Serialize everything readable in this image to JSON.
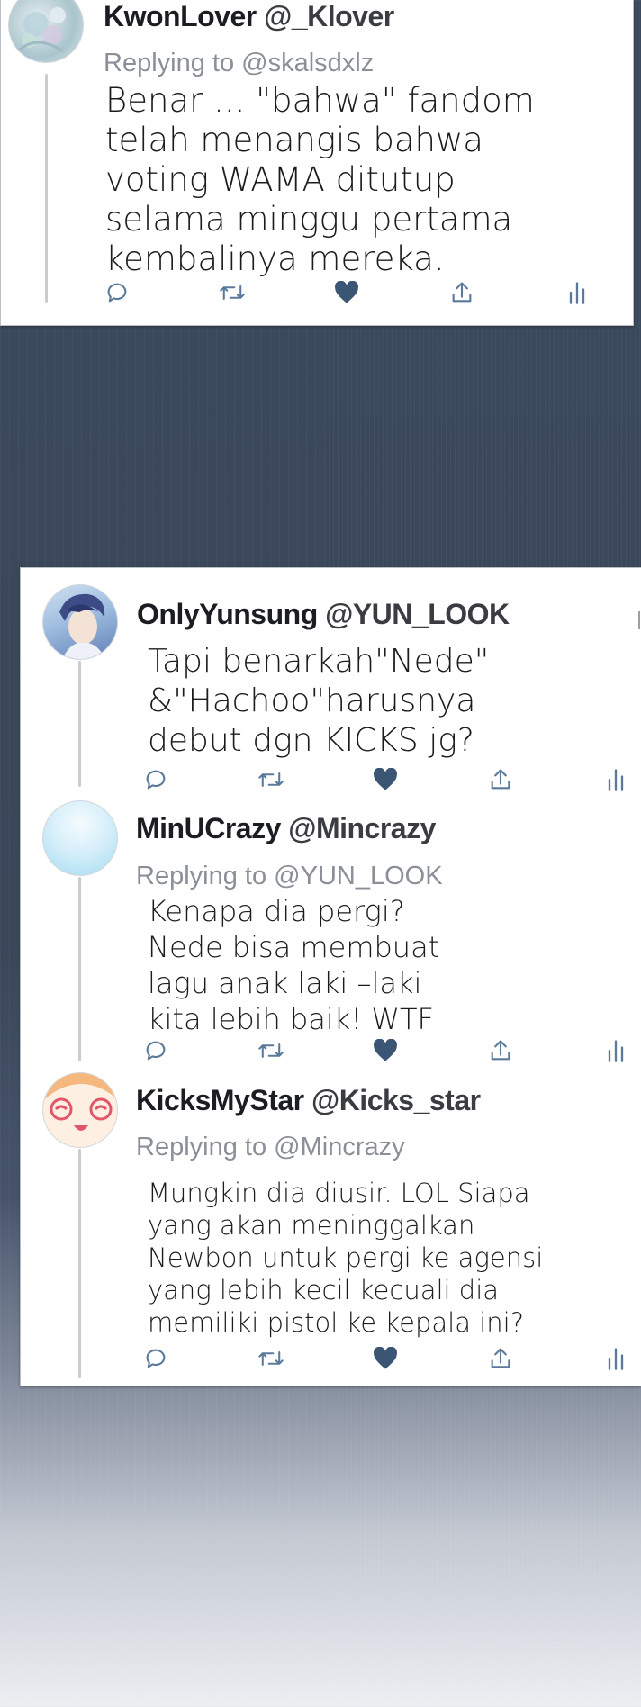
{
  "colors": {
    "text": "#1c1c1c",
    "muted": "#8a8f98",
    "icon": "#5b7a9a",
    "heart": "#3b5575",
    "background": "#3a4759"
  },
  "tweets": [
    {
      "name": "KwonLover",
      "handle": "@_Klover",
      "replying_label": "Replying to",
      "replying_to": "@skalsdxlz",
      "text": "Benar ... \"bahwa\" fandom\ntelah menangis bahwa\nvoting WAMA ditutup\nselama minggu pertama\nkembalinya mereka."
    },
    {
      "name": "OnlyYunsung",
      "handle": "@YUN_LOOK",
      "text": "Tapi benarkah\"Nede\"\n&\"Hachoo\"harusnya\ndebut dgn KICKS jg?"
    },
    {
      "name": "MinUCrazy",
      "handle": "@Mincrazy",
      "replying_label": "Replying to",
      "replying_to": "@YUN_LOOK",
      "text": "Kenapa dia pergi?\nNede bisa membuat\nlagu anak laki –laki\nkita lebih baik! WTF"
    },
    {
      "name": "KicksMyStar",
      "handle": "@Kicks_star",
      "replying_label": "Replying to",
      "replying_to": "@Mincrazy",
      "text": "Mungkin dia diusir. LOL Siapa\nyang akan meninggalkan\nNewbon untuk pergi ke agensi\nyang lebih kecil kecuali dia\nmemiliki pistol ke kepala ini?"
    }
  ],
  "action_icons": [
    "reply-icon",
    "retweet-icon",
    "like-icon",
    "share-icon",
    "analytics-icon"
  ]
}
